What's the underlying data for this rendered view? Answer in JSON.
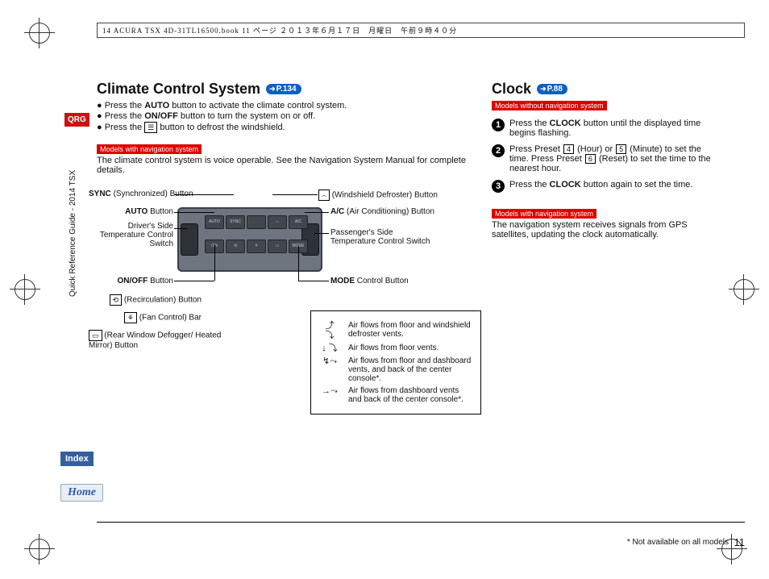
{
  "header": "14 ACURA TSX 4D-31TL16500.book  11 ページ  ２０１３年６月１７日　月曜日　午前９時４０分",
  "sidebar": {
    "qrg": "QRG",
    "guide": "Quick Reference Guide - 2014 TSX",
    "index": "Index",
    "home": "Home"
  },
  "climate": {
    "title": "Climate Control System",
    "pref": "P.134",
    "bullets": [
      "Press the AUTO button to activate the climate control system.",
      "Press the ON/OFF button to turn the system on or off.",
      "Press the 🔲 button to defrost the windshield."
    ],
    "navtag": "Models with navigation system",
    "navnote": "The climate control system is voice operable. See the Navigation System Manual for complete details.",
    "labels": {
      "sync": "SYNC (Synchronized) Button",
      "auto": "AUTO Button",
      "driver": "Driver's Side Temperature Control Switch",
      "onoff": "ON/OFF Button",
      "recirc_icon": "⟲",
      "recirc": "(Recirculation) Button",
      "fan_icon": "⚘",
      "fan": "(Fan Control) Bar",
      "rear_icon": "▭",
      "rear": "(Rear Window Defogger/ Heated Mirror) Button",
      "defrost_icon": "⌢",
      "defrost": "(Windshield Defroster) Button",
      "ac": "A/C (Air Conditioning) Button",
      "passenger": "Passenger's Side Temperature Control Switch",
      "mode": "MODE Control Button"
    },
    "legend": [
      {
        "icon": "⤴⤵",
        "text": "Air flows from floor and windshield defroster vents."
      },
      {
        "icon": "↓⤵",
        "text": "Air flows from floor vents."
      },
      {
        "icon": "↯⤳",
        "text": "Air flows from floor and dashboard vents, and back of the center console*."
      },
      {
        "icon": "→⤳",
        "text": "Air flows from dashboard vents and back of the center console*."
      }
    ]
  },
  "clock": {
    "title": "Clock",
    "pref": "P.88",
    "without_tag": "Models without navigation system",
    "steps": [
      "Press the CLOCK button until the displayed time begins flashing.",
      "Press Preset [4] (Hour) or [5] (Minute) to set the time. Press Preset [6] (Reset) to set the time to the nearest hour.",
      "Press the CLOCK button again to set the time."
    ],
    "with_tag": "Models with navigation system",
    "with_text": "The navigation system receives signals from GPS satellites, updating the clock automatically."
  },
  "footnote": "* Not available on all models",
  "page_num": "11"
}
